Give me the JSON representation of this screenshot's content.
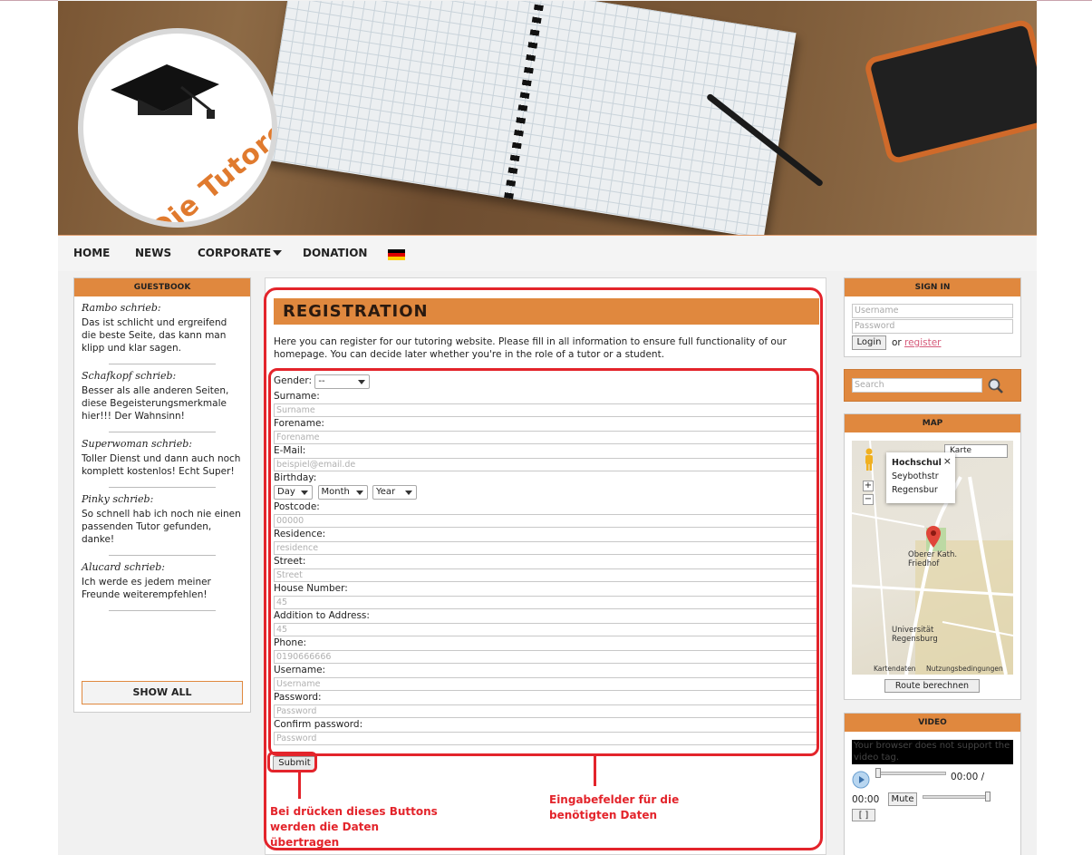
{
  "header": {
    "logo_text": "Die Tutoren AG"
  },
  "nav": {
    "items": [
      "HOME",
      "NEWS",
      "CORPORATE",
      "DONATION"
    ],
    "flag": "german-flag-icon"
  },
  "guestbook": {
    "title": "GUESTBOOK",
    "entries": [
      {
        "name": "Rambo schrieb:",
        "text": "Das ist schlicht und ergreifend die beste Seite, das kann man klipp und klar sagen."
      },
      {
        "name": "Schafkopf schrieb:",
        "text": "Besser als alle anderen Seiten, diese Begeisterungsmerkmale hier!!! Der Wahnsinn!"
      },
      {
        "name": "Superwoman schrieb:",
        "text": "Toller Dienst und dann auch noch komplett kostenlos! Echt Super!"
      },
      {
        "name": "Pinky schrieb:",
        "text": "So schnell hab ich noch nie einen passenden Tutor gefunden, danke!"
      },
      {
        "name": "Alucard schrieb:",
        "text": "Ich werde es jedem meiner Freunde weiterempfehlen!"
      }
    ],
    "show_all": "SHOW ALL"
  },
  "registration": {
    "title": "REGISTRATION",
    "intro": "Here you can register for our tutoring website. Please fill in all information to ensure full functionality of our homepage. You can decide later whether you're in the role of a tutor or a student.",
    "gender_label": "Gender:",
    "gender_value": "--",
    "birthday_label": "Birthday:",
    "birthday": {
      "day": "Day",
      "month": "Month",
      "year": "Year"
    },
    "fields": {
      "surname": {
        "label": "Surname:",
        "placeholder": "Surname"
      },
      "forename": {
        "label": "Forename:",
        "placeholder": "Forename"
      },
      "email": {
        "label": "E-Mail:",
        "placeholder": "beispiel@email.de"
      },
      "postcode": {
        "label": "Postcode:",
        "placeholder": "00000"
      },
      "residence": {
        "label": "Residence:",
        "placeholder": "residence"
      },
      "street": {
        "label": "Street:",
        "placeholder": "Street"
      },
      "house_number": {
        "label": "House Number:",
        "placeholder": "45"
      },
      "addition": {
        "label": "Addition to Address:",
        "placeholder": "45"
      },
      "phone": {
        "label": "Phone:",
        "placeholder": "0190666666"
      },
      "username": {
        "label": "Username:",
        "placeholder": "Username"
      },
      "password": {
        "label": "Password:",
        "placeholder": "Password"
      },
      "confirm": {
        "label": "Confirm password:",
        "placeholder": "Password"
      }
    },
    "submit": "Submit"
  },
  "annotations": {
    "submit_note": "Bei drücken dieses Buttons werden die Daten übertragen",
    "fields_note": "Eingabefelder für die benötigten Daten",
    "color": "#e3242b"
  },
  "signin": {
    "title": "SIGN IN",
    "username_placeholder": "Username",
    "password_placeholder": "Password",
    "login": "Login",
    "or": "or",
    "register": "register"
  },
  "search": {
    "placeholder": "Search"
  },
  "map": {
    "title": "MAP",
    "type_select": "Karte",
    "popup_title": "Hochschul",
    "popup_line1": "Seybothstr",
    "popup_line2": "Regensbur",
    "place1": "Oberer Kath. Friedhof",
    "place2": "Universität Regensburg",
    "credits": "Kartendaten",
    "terms": "Nutzungsbedingungen",
    "route": "Route berechnen"
  },
  "video": {
    "title": "VIDEO",
    "unsupported": "Your browser does not support the video tag.",
    "time1": "00:00 /",
    "time2": "00:00",
    "mute": "Mute",
    "fullscreen": "[ ]"
  },
  "colors": {
    "accent": "#e0883e",
    "page_bg": "#f1f1f1"
  }
}
